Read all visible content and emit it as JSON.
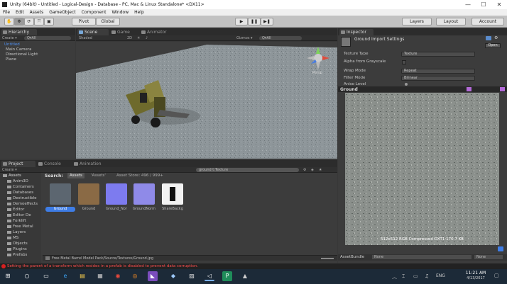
{
  "window": {
    "title": "Unity (64bit) - Untitled - Logical-Design - Database - PC, Mac & Linux Standalone* <DX11>",
    "minimize": "—",
    "maximize": "☐",
    "close": "✕"
  },
  "menu": [
    "File",
    "Edit",
    "Assets",
    "GameObject",
    "Component",
    "Window",
    "Help"
  ],
  "toolbar": {
    "pivot": "Pivot",
    "global": "Global",
    "layers": "Layers",
    "layout": "Layout",
    "account": "Account"
  },
  "hierarchy": {
    "tab": "Hierarchy",
    "create": "Create ▾",
    "search": "Q▾All",
    "scene": "Untitled",
    "items": [
      "Main Camera",
      "Directional Light",
      "Plane"
    ]
  },
  "scene": {
    "tab": "Scene",
    "game_tab": "Game",
    "animator_tab": "Animator",
    "shading": "Shaded",
    "mode": "2D",
    "gizmos": "Gizmos ▾",
    "search": "Q▾All",
    "persp": "Persp"
  },
  "inspector": {
    "tab": "Inspector",
    "title": "Ground Import Settings",
    "open": "Open",
    "rows": [
      {
        "label": "Texture Type",
        "value": "Texture"
      },
      {
        "label": "Alpha from Grayscale",
        "value": ""
      },
      {
        "label": "Wrap Mode",
        "value": "Repeat"
      },
      {
        "label": "Filter Mode",
        "value": "Bilinear"
      },
      {
        "label": "Aniso Level",
        "value": ""
      }
    ],
    "preview_title": "Ground",
    "preview_info": "512x512  RGB Compressed DXT1  170.7 KB",
    "assetbundle_label": "AssetBundle",
    "assetbundle_value": "None",
    "assetbundle_variant": "None"
  },
  "project": {
    "tab": "Project",
    "console_tab": "Console",
    "animation_tab": "Animation",
    "create": "Create ▾",
    "search": "ground t:Texture",
    "search_label": "Search:",
    "scope_assets": "Assets",
    "scope_quoted": "'Assets'",
    "store": "Asset Store: 496 / 999+",
    "folders": [
      "Assets",
      "Anim3D",
      "Containers",
      "Databases",
      "Destructible",
      "Demoeffects",
      "Editor",
      "Editor De",
      "Forklift",
      "Free Metal",
      "Layers",
      "MS",
      "Objects",
      "Plugins",
      "Prefabs"
    ],
    "assets": [
      {
        "label": "Ground",
        "color": "#5c6670"
      },
      {
        "label": "Ground",
        "color": "#8a6a45"
      },
      {
        "label": "Ground_Nor",
        "color": "#7d7bef"
      },
      {
        "label": "GroundNorm",
        "color": "#8f8ae8"
      },
      {
        "label": "ShareBackg",
        "color": "#f2f2f2"
      }
    ],
    "path": "Free Metal Barrel Model Pack/Source/Textures/Ground.jpg"
  },
  "status": {
    "message": "Setting the parent of a transform which resides in a prefab is disabled to prevent data corruption."
  },
  "taskbar": {
    "time": "11:21 AM",
    "date": "4/13/2017",
    "lang": "ENG"
  },
  "colors": {
    "accent": "#3e7de6",
    "error": "#d82020",
    "sky": "#3c3c3c"
  }
}
